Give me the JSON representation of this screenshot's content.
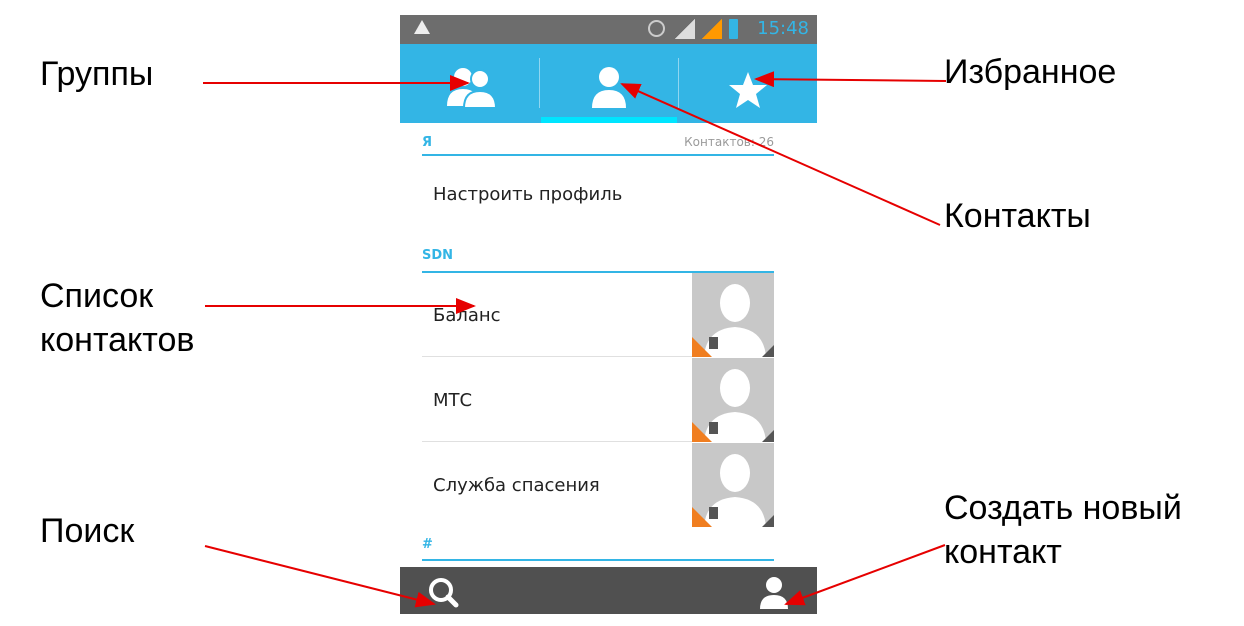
{
  "callouts": {
    "groups": "Группы",
    "favorites": "Избранное",
    "contacts": "Контакты",
    "contact_list_line1": "Список",
    "contact_list_line2": "контактов",
    "search": "Поиск",
    "create_contact_line1": "Создать новый",
    "create_contact_line2": "контакт"
  },
  "status_bar": {
    "time": "15:48",
    "icons": [
      "warning-icon",
      "alarm-icon",
      "signal-sim1-icon",
      "signal-sim2-icon",
      "battery-icon"
    ]
  },
  "tabs": [
    {
      "name": "groups",
      "icon": "groups-icon"
    },
    {
      "name": "contacts",
      "icon": "person-icon",
      "selected": true
    },
    {
      "name": "favorites",
      "icon": "star-icon"
    }
  ],
  "list": {
    "me_header": "Я",
    "contacts_count": "Контактов: 26",
    "setup_profile": "Настроить профиль",
    "sdn_header": "SDN",
    "items": [
      "Баланс",
      "МТС",
      "Служба спасения"
    ],
    "hash_header": "#"
  },
  "bottom_bar": {
    "icons": [
      "search-icon",
      "add-contact-icon"
    ]
  },
  "colors": {
    "accent": "#33b5e5",
    "tab_indicator": "#00e5ff",
    "status_bar": "#6d6d6d",
    "bottom_bar": "#505050",
    "arrow": "#e60000"
  }
}
